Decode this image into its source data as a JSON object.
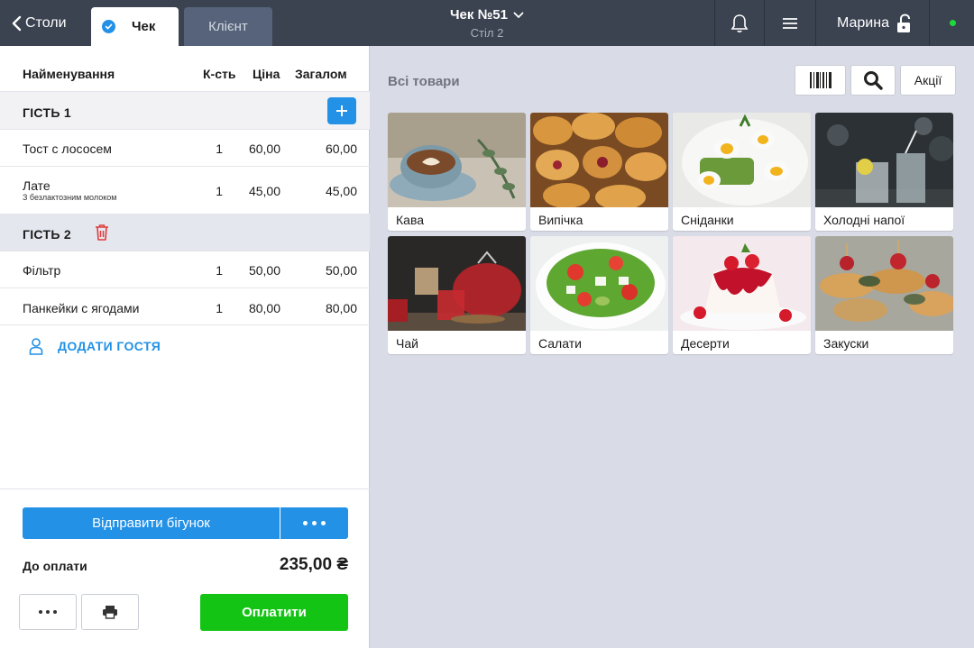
{
  "topbar": {
    "back_label": "Столи",
    "tab_check": "Чек",
    "tab_client": "Клієнт",
    "title": "Чек №51",
    "subtitle": "Стіл 2",
    "user_name": "Марина",
    "online_color": "#1ed93a"
  },
  "order": {
    "columns": {
      "name": "Найменування",
      "qty": "К-сть",
      "price": "Ціна",
      "total": "Загалом"
    },
    "guest1": {
      "label": "ГІСТЬ 1",
      "items": [
        {
          "name": "Тост с лососем",
          "note": "",
          "qty": "1",
          "price": "60,00",
          "total": "60,00"
        },
        {
          "name": "Лате",
          "note": "З безлактозним молоком",
          "qty": "1",
          "price": "45,00",
          "total": "45,00"
        }
      ]
    },
    "guest2": {
      "label": "ГІСТЬ 2",
      "items": [
        {
          "name": "Фільтр",
          "qty": "1",
          "price": "50,00",
          "total": "50,00"
        },
        {
          "name": "Панкейки с ягодами",
          "qty": "1",
          "price": "80,00",
          "total": "80,00"
        }
      ]
    },
    "add_guest": "ДОДАТИ ГОСТЯ",
    "send_label": "Відправити бігунок",
    "due_label": "До оплати",
    "due_amount": "235,00 ₴",
    "pay_label": "Оплатити"
  },
  "catalog": {
    "title": "Всі товари",
    "promo_label": "Акції",
    "categories": [
      {
        "label": "Кава",
        "icon": "coffee-photo"
      },
      {
        "label": "Випічка",
        "icon": "pastry-photo"
      },
      {
        "label": "Сніданки",
        "icon": "breakfast-photo"
      },
      {
        "label": "Холодні напої",
        "icon": "cold-drinks-photo"
      },
      {
        "label": "Чай",
        "icon": "tea-photo"
      },
      {
        "label": "Салати",
        "icon": "salad-photo"
      },
      {
        "label": "Десерти",
        "icon": "dessert-photo"
      },
      {
        "label": "Закуски",
        "icon": "snacks-photo"
      }
    ]
  },
  "colors": {
    "accent": "#2291e6",
    "pay": "#14c414",
    "topbar": "#3b4250",
    "danger": "#e03b3b"
  }
}
